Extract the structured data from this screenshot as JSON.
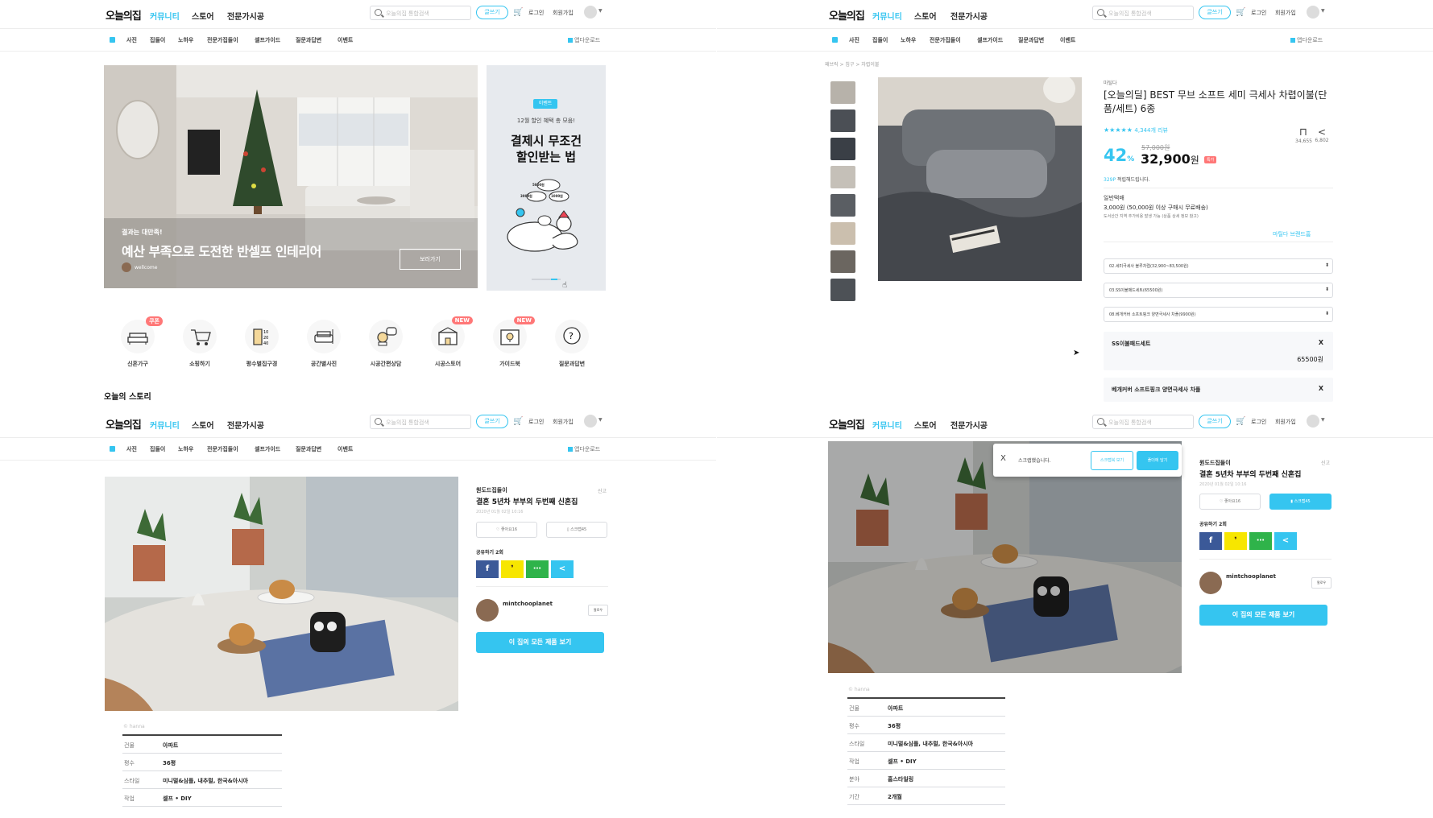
{
  "header": {
    "logo": "오늘의집",
    "menu": [
      "커뮤니티",
      "스토어",
      "전문가시공"
    ],
    "search_placeholder": "오늘의집 통합검색",
    "write_label": "글쓰기",
    "cart_icon": "cart-icon",
    "login": "로그인",
    "signup": "회원가입"
  },
  "subnav": {
    "items": [
      "사진",
      "집들이",
      "노하우",
      "전문가집들이",
      "셀프가이드",
      "질문과답변",
      "이벤트"
    ],
    "app_download": "앱다운로드"
  },
  "home": {
    "hero_kicker": "결과는 대만족!",
    "hero_title": "예산 부족으로 도전한 반셀프 인테리어",
    "hero_author": "wellcome",
    "hero_button": "보러가기",
    "banner_badge": "이벤트",
    "banner_sub": "12월 할인 혜택 총 모음!",
    "banner_title_1": "결제시 무조건",
    "banner_title_2": "할인받는 법",
    "coins": [
      "5000원",
      "3000원",
      "1000원"
    ],
    "categories": [
      {
        "label": "신혼가구",
        "tag": "쿠폰",
        "icon": "sofa-icon"
      },
      {
        "label": "쇼핑하기",
        "tag": "",
        "icon": "cart-icon"
      },
      {
        "label": "평수별집구경",
        "tag": "",
        "icon": "floor-size-icon"
      },
      {
        "label": "공간별사진",
        "tag": "",
        "icon": "room-icon"
      },
      {
        "label": "시공간편상담",
        "tag": "",
        "icon": "consult-icon"
      },
      {
        "label": "시공스토어",
        "tag": "NEW",
        "icon": "store-icon"
      },
      {
        "label": "가이드북",
        "tag": "NEW",
        "icon": "guide-icon"
      },
      {
        "label": "질문과답변",
        "tag": "",
        "icon": "question-icon"
      }
    ],
    "section_title": "오늘의 스토리"
  },
  "product": {
    "breadcrumb": "패브릭 > 침구 > 차렵이불",
    "brand": "마틸다",
    "title": "[오늘의딜] BEST 무브 소프트 세미 극세사 차렵이불(단품/세트) 6종",
    "rating": "★★★★★",
    "review_count": "4,344개 리뷰",
    "scrap_count": "34,655",
    "share_count": "6,802",
    "discount": "42",
    "discount_unit": "%",
    "original_price": "57,000원",
    "price": "32,900",
    "price_unit": "원",
    "special_badge": "특가",
    "points_value": "329P",
    "points_text": "적립해드립니다.",
    "ship_type": "일반택배",
    "ship_fee": "3,000원 (50,000원 이상 구매시 무료배송)",
    "ship_note": "도서산간 지역 추가비용 발생 가능 (상품 상세 정보 참고)",
    "brand_home": "마틸다 브랜드홈",
    "selects": [
      "02.세미극세사 블루차렵(32,900~83,500원)",
      "03.SS이불패드세트(65500원)",
      "08.베개커버 소프트핑크 양면극세사 차플(9900원)"
    ],
    "option1_name": "SS이불패드세트",
    "option1_price": "65500원",
    "option2_name": "베개커버 소프트핑크 양면극세사 차플",
    "close": "X"
  },
  "post": {
    "category": "원도드집들이",
    "title": "결혼 5년차 부부의 두번째 신혼집",
    "date": "2020년 01월 02일 10:16",
    "report": "신고",
    "like_label": "좋아요16",
    "scrap_label": "스크랩45",
    "share_label": "공유하기 2회",
    "share_icons": [
      "f",
      "❜",
      "⋯",
      "<"
    ],
    "author": "mintchooplanet",
    "follow": "팔로우",
    "all_products": "이 집의 모든 제품 보기",
    "credit": "© hanna",
    "specs_q3": [
      {
        "k": "건물",
        "v": "아파트"
      },
      {
        "k": "평수",
        "v": "36평"
      },
      {
        "k": "스타일",
        "v": "미니멀&심플, 내추럴, 한국&아시아"
      },
      {
        "k": "작업",
        "v": "셀프 • DIY"
      }
    ],
    "specs_q4": [
      {
        "k": "건물",
        "v": "아파트"
      },
      {
        "k": "평수",
        "v": "36평"
      },
      {
        "k": "스타일",
        "v": "미니멀&심플, 내추럴, 한국&아시아"
      },
      {
        "k": "작업",
        "v": "셀프 • DIY"
      },
      {
        "k": "분야",
        "v": "홈스타일링"
      },
      {
        "k": "기간",
        "v": "2개월"
      }
    ],
    "toast_close": "X",
    "toast_msg": "스크랩했습니다.",
    "toast_view": "스크랩북 보기",
    "toast_folder": "폴더에 담기"
  },
  "colors": {
    "accent": "#35c5f0",
    "facebook": "#3b5998",
    "kakao": "#f7e600",
    "talk": "#2fb34a",
    "share": "#35c5f0",
    "badge": "#f77777"
  }
}
